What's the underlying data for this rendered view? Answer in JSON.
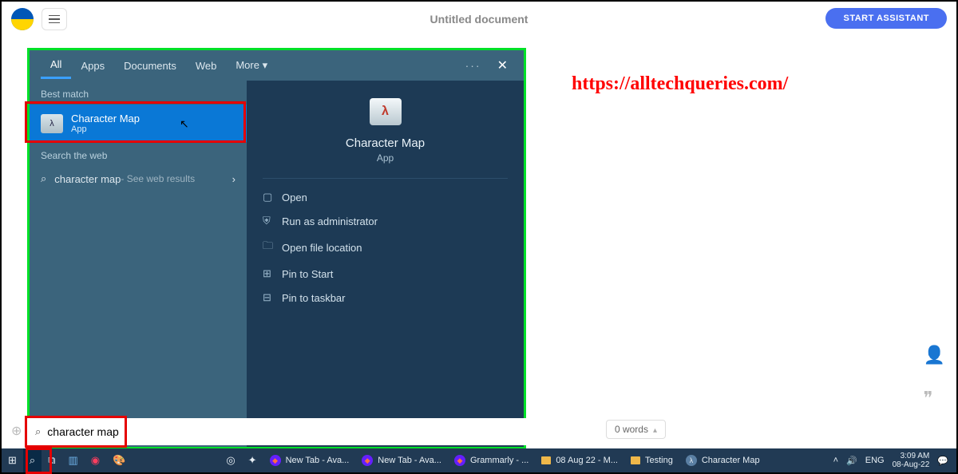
{
  "header": {
    "doc_title": "Untitled document",
    "start_assistant": "START ASSISTANT"
  },
  "watermark_url": "https://alltechqueries.com/",
  "search": {
    "tabs": {
      "all": "All",
      "apps": "Apps",
      "documents": "Documents",
      "web": "Web",
      "more": "More ▾"
    },
    "best_match_label": "Best match",
    "result": {
      "title": "Character Map",
      "subtitle": "App"
    },
    "search_web_label": "Search the web",
    "web_row": {
      "query": "character map",
      "suffix": " - See web results"
    },
    "hero": {
      "title": "Character Map",
      "subtitle": "App"
    },
    "actions": {
      "open": "Open",
      "run_admin": "Run as administrator",
      "open_loc": "Open file location",
      "pin_start": "Pin to Start",
      "pin_taskbar": "Pin to taskbar"
    },
    "input_value": "character map"
  },
  "footer": {
    "word_count": "0 words"
  },
  "taskbar": {
    "items": [
      {
        "label": "New Tab - Ava..."
      },
      {
        "label": "New Tab - Ava..."
      },
      {
        "label": "Grammarly - ..."
      },
      {
        "label": "08 Aug 22 - M..."
      },
      {
        "label": "Testing"
      },
      {
        "label": "Character Map"
      }
    ],
    "lang": "ENG",
    "time": "3:09 AM",
    "date": "08-Aug-22"
  }
}
